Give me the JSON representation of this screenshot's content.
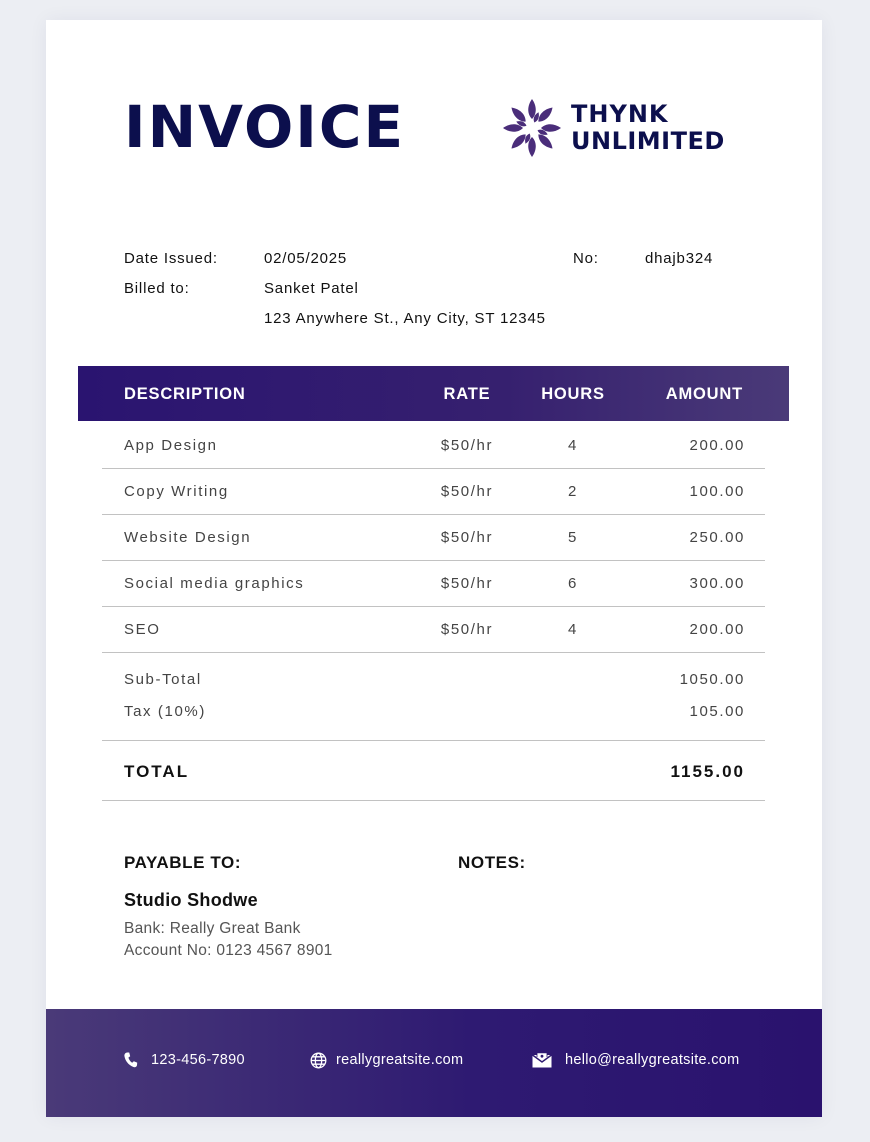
{
  "header": {
    "title": "INVOICE"
  },
  "brand": {
    "line1": "THYNK",
    "line2": "UNLIMITED",
    "icon": "flower-logo-icon",
    "color": "#4a2d7a"
  },
  "meta": {
    "date_label": "Date Issued:",
    "date_value": "02/05/2025",
    "no_label": "No:",
    "no_value": "dhajb324",
    "billed_label": "Billed to:",
    "billed_name": "Sanket Patel",
    "billed_address": "123 Anywhere St., Any City, ST 12345"
  },
  "table": {
    "headers": {
      "description": "DESCRIPTION",
      "rate": "RATE",
      "hours": "HOURS",
      "amount": "AMOUNT"
    },
    "rows": [
      {
        "description": "App Design",
        "rate": "$50/hr",
        "hours": "4",
        "amount": "200.00"
      },
      {
        "description": "Copy Writing",
        "rate": "$50/hr",
        "hours": "2",
        "amount": "100.00"
      },
      {
        "description": "Website Design",
        "rate": "$50/hr",
        "hours": "5",
        "amount": "250.00"
      },
      {
        "description": "Social media graphics",
        "rate": "$50/hr",
        "hours": "6",
        "amount": "300.00"
      },
      {
        "description": "SEO",
        "rate": "$50/hr",
        "hours": "4",
        "amount": "200.00"
      }
    ]
  },
  "summary": {
    "subtotal_label": "Sub-Total",
    "subtotal_value": "1050.00",
    "tax_label": "Tax (10%)",
    "tax_value": "105.00",
    "total_label": "TOTAL",
    "total_value": "1155.00"
  },
  "payable": {
    "heading": "PAYABLE TO:",
    "name": "Studio Shodwe",
    "bank": "Bank: Really Great Bank",
    "account": "Account No: 0123 4567 8901"
  },
  "notes": {
    "heading": "NOTES:"
  },
  "footer": {
    "phone": "123-456-7890",
    "phone_icon": "phone-icon",
    "website": "reallygreatsite.com",
    "website_icon": "globe-icon",
    "email": "hello@reallygreatsite.com",
    "email_icon": "mail-icon"
  },
  "colors": {
    "header_band": "#2a1470",
    "title": "#0c0f4d",
    "footer_band": "#2e1a72"
  }
}
